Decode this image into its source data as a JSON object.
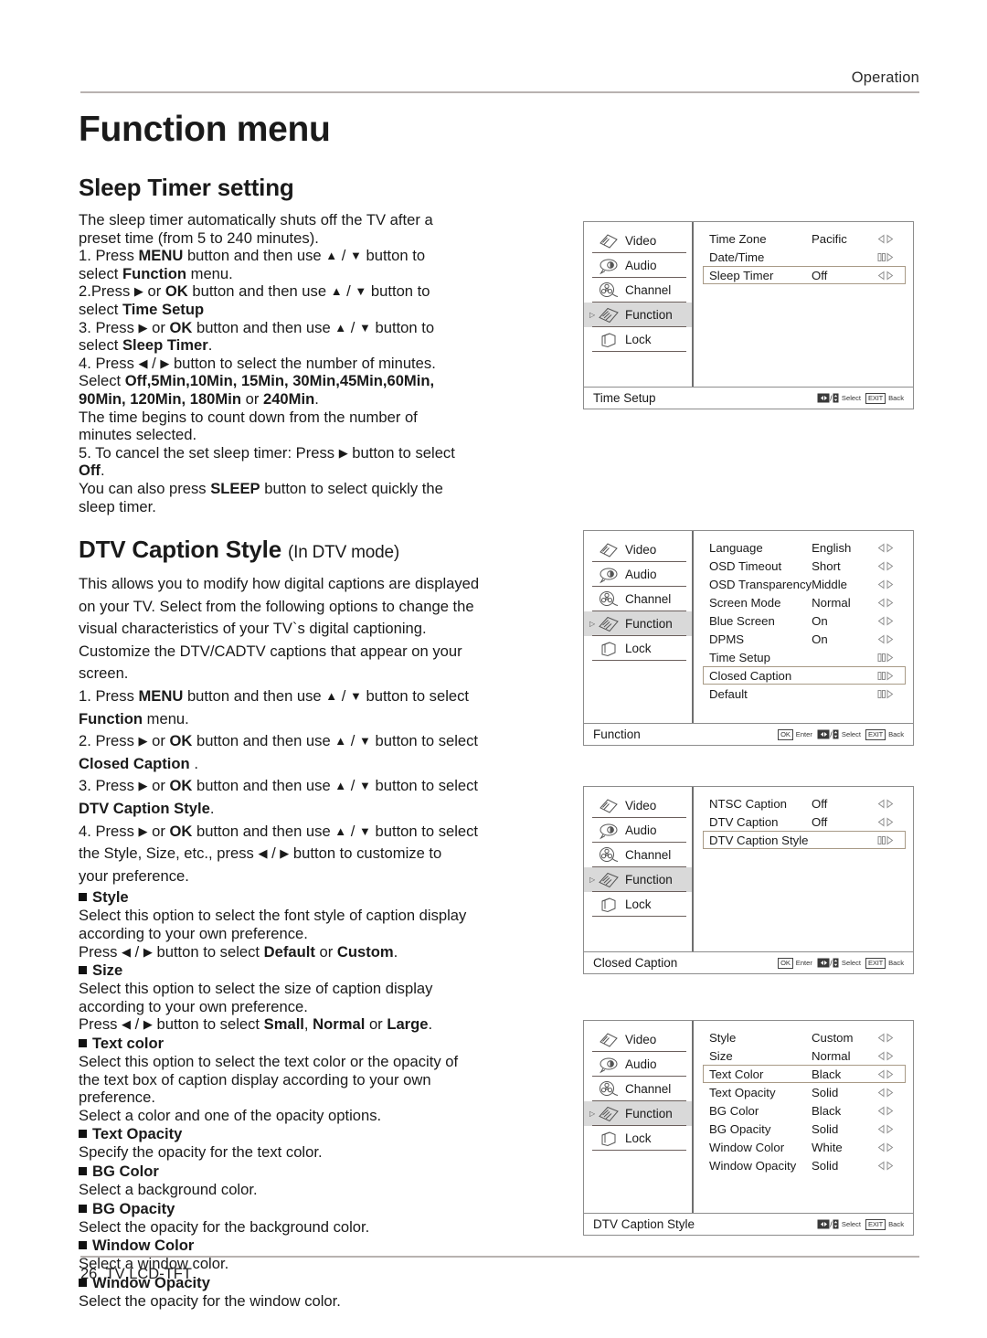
{
  "header": {
    "chapter": "Operation"
  },
  "page_title": "Function menu",
  "sections": {
    "sleep": {
      "title": "Sleep Timer setting",
      "lines": [
        "The sleep timer automatically shuts off the TV after a",
        "preset time (from 5 to 240 minutes).",
        "1. Press MENU button and then use ▲ / ▼ button to",
        "select Function menu.",
        "2.Press ▶ or OK button and then use ▲ / ▼ button to",
        "select Time Setup",
        "3. Press ▶ or OK button and then use ▲ / ▼ button to",
        "select Sleep Timer.",
        "4. Press ◀ / ▶ button to select the number of minutes.",
        "Select Off,5Min,10Min, 15Min, 30Min,45Min,60Min,",
        "90Min, 120Min, 180Min or 240Min.",
        "The time begins to count down from the number of",
        "minutes selected.",
        "5. To cancel the set sleep timer: Press ▶ button to select",
        "Off.",
        "You can also press SLEEP button to select quickly the",
        "sleep timer."
      ]
    },
    "dtv": {
      "title": "DTV Caption Style",
      "title_sub": "(In DTV mode)",
      "intro": [
        "This allows you to modify how digital captions are displayed",
        "on your TV. Select from the following options to change the",
        "visual characteristics of your TV`s digital captioning.",
        "Customize the DTV/CADTV captions that appear on your",
        "screen."
      ],
      "steps": [
        "1. Press MENU button and then use ▲ / ▼ button to select",
        "Function menu.",
        "2. Press ▶ or OK button and then use ▲ / ▼ button to select",
        "Closed Caption .",
        "3. Press ▶ or OK button and then use ▲ / ▼ button to select",
        "DTV Caption Style.",
        "4. Press ▶ or OK button and then use ▲ / ▼ button to select",
        "the Style, Size, etc., press ◀ / ▶  button to customize to",
        "your preference."
      ],
      "options": [
        {
          "name": "Style",
          "desc": [
            "Select this option to select the font style of caption display",
            "according to your own preference.",
            "Press ◀ / ▶  button to select Default or Custom."
          ]
        },
        {
          "name": "Size",
          "desc": [
            "Select this option to select the size of caption display",
            "according to your own preference.",
            "Press ◀ / ▶  button to select Small, Normal or Large."
          ]
        },
        {
          "name": "Text color",
          "desc": [
            "Select this option to select the text color or the opacity of",
            "the text box of caption display according to your own",
            "preference.",
            "Select a color and one of the opacity options."
          ]
        },
        {
          "name": "Text Opacity",
          "desc": [
            "Specify the opacity for the text color."
          ]
        },
        {
          "name": "BG Color",
          "desc": [
            "Select a background color."
          ]
        },
        {
          "name": "BG Opacity",
          "desc": [
            "Select the opacity for the background color."
          ]
        },
        {
          "name": "Window Color",
          "desc": [
            "Select a window  color."
          ]
        },
        {
          "name": "Window Opacity",
          "desc": [
            "Select the opacity for the window color."
          ]
        }
      ]
    }
  },
  "footer": {
    "page_number": "26",
    "model": "TV LCD-TFT"
  },
  "osd_common": {
    "sidebar": [
      {
        "label": "Video",
        "icon": "video-icon",
        "active": false
      },
      {
        "label": "Audio",
        "icon": "audio-icon",
        "active": false
      },
      {
        "label": "Channel",
        "icon": "channel-icon",
        "active": false
      },
      {
        "label": "Function",
        "icon": "function-icon",
        "active": true
      },
      {
        "label": "Lock",
        "icon": "lock-icon",
        "active": false
      }
    ],
    "hint_ok": "OK",
    "hint_enter": "Enter",
    "hint_select": "Select",
    "hint_exit": "EXIT",
    "hint_back": "Back",
    "adj_lr": "◁▷",
    "adj_enter": "▐▷",
    "highlight_border": "#a89a86",
    "active_bg": "#d9d9d9"
  },
  "osd_panels": [
    {
      "id": "time-setup",
      "footer_title": "Time Setup",
      "show_ok_hint": false,
      "rows": [
        {
          "label": "Time Zone",
          "value": "Pacific",
          "adj": "lr",
          "selected": false
        },
        {
          "label": "Date/Time",
          "value": "",
          "adj": "enter",
          "selected": false
        },
        {
          "label": "Sleep Timer",
          "value": "Off",
          "adj": "lr",
          "selected": true
        }
      ]
    },
    {
      "id": "function",
      "footer_title": "Function",
      "show_ok_hint": true,
      "rows": [
        {
          "label": "Language",
          "value": "English",
          "adj": "lr",
          "selected": false
        },
        {
          "label": "OSD Timeout",
          "value": "Short",
          "adj": "lr",
          "selected": false
        },
        {
          "label": "OSD Transparency",
          "value": "Middle",
          "adj": "lr",
          "selected": false
        },
        {
          "label": "Screen Mode",
          "value": "Normal",
          "adj": "lr",
          "selected": false
        },
        {
          "label": "Blue Screen",
          "value": "On",
          "adj": "lr",
          "selected": false
        },
        {
          "label": "DPMS",
          "value": "On",
          "adj": "lr",
          "selected": false
        },
        {
          "label": "Time Setup",
          "value": "",
          "adj": "enter",
          "selected": false
        },
        {
          "label": "Closed Caption",
          "value": "",
          "adj": "enter",
          "selected": true
        },
        {
          "label": "Default",
          "value": "",
          "adj": "enter",
          "selected": false
        }
      ]
    },
    {
      "id": "closed-caption",
      "footer_title": "Closed Caption",
      "show_ok_hint": true,
      "rows": [
        {
          "label": "NTSC Caption",
          "value": "Off",
          "adj": "lr",
          "selected": false
        },
        {
          "label": "DTV Caption",
          "value": "Off",
          "adj": "lr",
          "selected": false
        },
        {
          "label": "DTV Caption Style",
          "value": "",
          "adj": "enter",
          "selected": true
        }
      ]
    },
    {
      "id": "dtv-caption-style",
      "footer_title": "DTV Caption Style",
      "show_ok_hint": false,
      "rows": [
        {
          "label": "Style",
          "value": "Custom",
          "adj": "lr",
          "selected": false
        },
        {
          "label": "Size",
          "value": "Normal",
          "adj": "lr",
          "selected": false
        },
        {
          "label": "Text Color",
          "value": "Black",
          "adj": "lr",
          "selected": true
        },
        {
          "label": "Text Opacity",
          "value": "Solid",
          "adj": "lr",
          "selected": false
        },
        {
          "label": "BG  Color",
          "value": "Black",
          "adj": "lr",
          "selected": false
        },
        {
          "label": "BG Opacity",
          "value": "Solid",
          "adj": "lr",
          "selected": false
        },
        {
          "label": "Window Color",
          "value": "White",
          "adj": "lr",
          "selected": false
        },
        {
          "label": "Window Opacity",
          "value": "Solid",
          "adj": "lr",
          "selected": false
        }
      ]
    }
  ]
}
